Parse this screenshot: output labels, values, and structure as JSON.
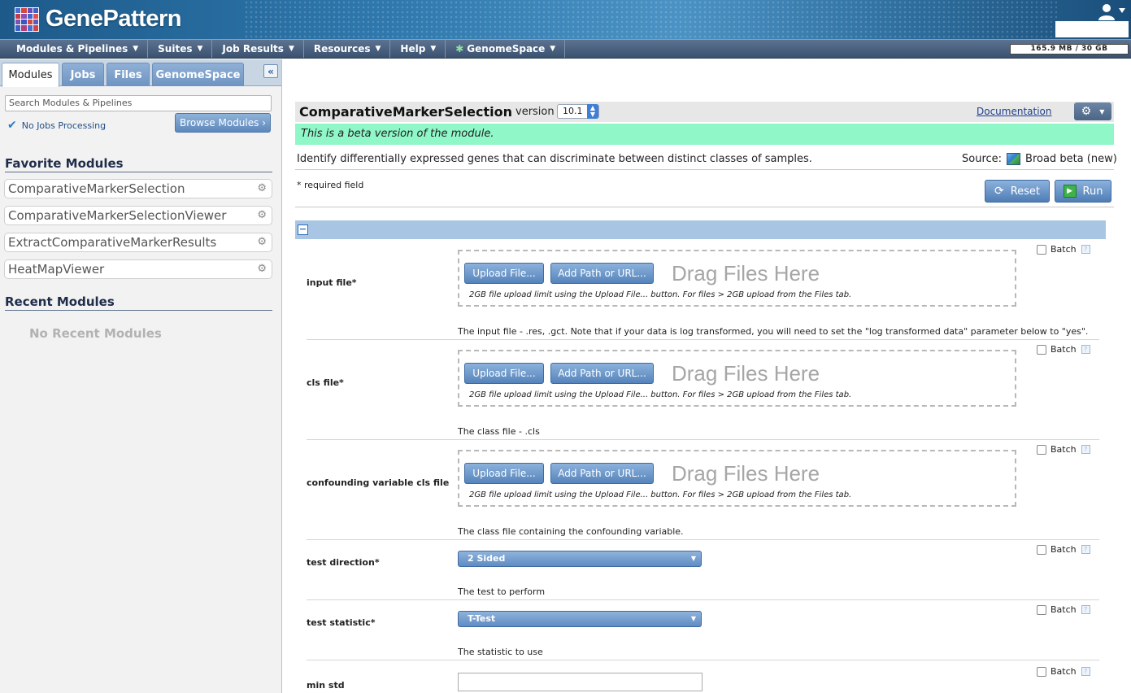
{
  "app": {
    "title": "GenePattern",
    "quota": "165.9 MB / 30 GB"
  },
  "nav": {
    "items": [
      {
        "label": "Modules & Pipelines"
      },
      {
        "label": "Suites"
      },
      {
        "label": "Job Results"
      },
      {
        "label": "Resources"
      },
      {
        "label": "Help"
      },
      {
        "label": "GenomeSpace"
      }
    ]
  },
  "left": {
    "tabs": [
      "Modules",
      "Jobs",
      "Files",
      "GenomeSpace"
    ],
    "active_tab": "Modules",
    "search_placeholder": "Search Modules & Pipelines",
    "jobs_status": "No Jobs Processing",
    "browse_label": "Browse Modules ›",
    "favorites_title": "Favorite Modules",
    "favorites": [
      "ComparativeMarkerSelection",
      "ComparativeMarkerSelectionViewer",
      "ExtractComparativeMarkerResults",
      "HeatMapViewer"
    ],
    "recent_title": "Recent Modules",
    "recent_empty": "No Recent Modules"
  },
  "module": {
    "name": "ComparativeMarkerSelection",
    "version_label": "version",
    "version": "10.1",
    "documentation": "Documentation",
    "beta_notice": "This is a beta version of the module.",
    "description": "Identify differentially expressed genes that can discriminate between distinct classes of samples.",
    "source_label": "Source:",
    "source_value": "Broad beta (new)",
    "required_note": "* required field",
    "reset_label": "Reset",
    "run_label": "Run"
  },
  "dropzone": {
    "upload_label": "Upload File...",
    "add_path_label": "Add Path or URL...",
    "drag_text": "Drag Files Here",
    "note": "2GB file upload limit using the Upload File... button. For files > 2GB upload from the Files tab."
  },
  "batch_label": "Batch",
  "params": [
    {
      "label": "input file*",
      "desc": "The input file - .res, .gct. Note that if your data is log transformed, you will need to set the \"log transformed data\" parameter below to \"yes\"."
    },
    {
      "label": "cls file*",
      "desc": "The class file - .cls"
    },
    {
      "label": "confounding variable cls file",
      "desc": "The class file containing the confounding variable."
    },
    {
      "label": "test direction*",
      "value": "2 Sided",
      "desc": "The test to perform"
    },
    {
      "label": "test statistic*",
      "value": "T-Test",
      "desc": "The statistic to use"
    },
    {
      "label": "min std",
      "value": ""
    }
  ],
  "colors": {
    "beta_bg": "#8ff7c8",
    "header_blue": "#2f79ae",
    "group_bar": "#a8c6e4"
  }
}
